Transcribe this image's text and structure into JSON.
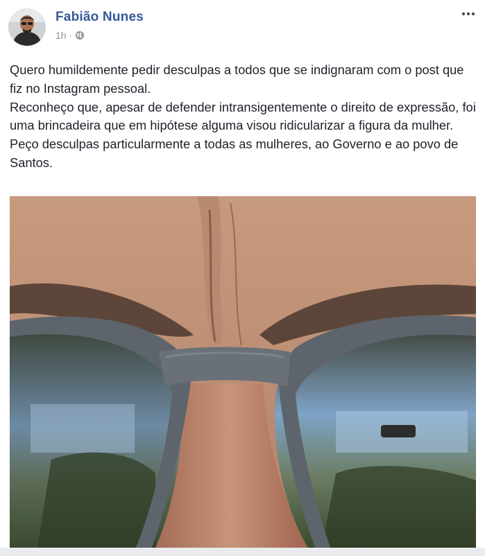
{
  "post": {
    "author": "Fabião Nunes",
    "time": "1h",
    "separator": "·",
    "privacy_icon": "globe-icon",
    "more_icon": "more-options-icon",
    "paragraphs": [
      "Quero humildemente pedir desculpas a todos que se indignaram com o post que fiz no Instagram pessoal.",
      "Reconheço que, apesar de defender intransigentemente o direito de expressão, foi uma brincadeira que em hipótese alguma visou ridicularizar a figura da mulher.",
      "Peço desculpas particularmente a todas as mulheres, ao Governo e ao povo de Santos."
    ]
  },
  "colors": {
    "author_link": "#365899",
    "meta_gray": "#90949c",
    "body_text": "#1d2129"
  }
}
